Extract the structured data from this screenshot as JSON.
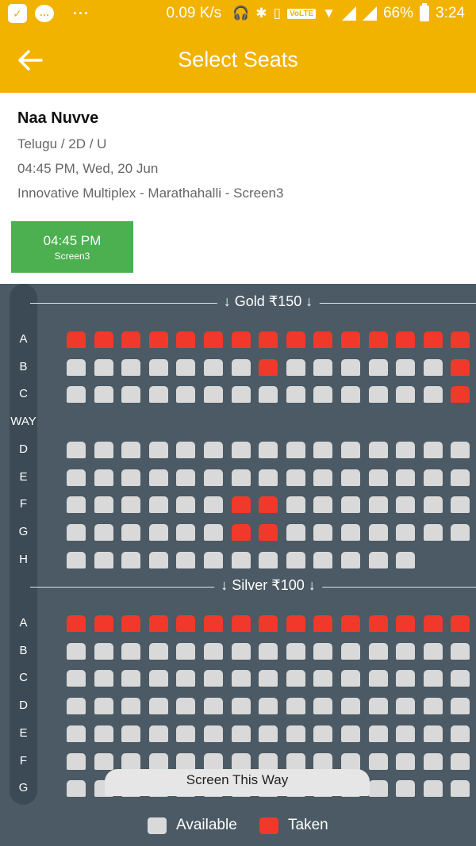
{
  "status_bar": {
    "speed": "0.09 K/s",
    "volte": "VoLTE",
    "battery": "66%",
    "time": "3:24",
    "dots": "···"
  },
  "app_bar": {
    "title": "Select Seats",
    "back_icon": "arrow-left-icon"
  },
  "movie": {
    "title": "Naa Nuvve",
    "meta": "Telugu / 2D / U",
    "datetime": "04:45 PM, Wed, 20 Jun",
    "venue": "Innovative Multiplex - Marathahalli - Screen3"
  },
  "showtime": {
    "time": "04:45 PM",
    "screen": "Screen3"
  },
  "colors": {
    "accent": "#f2b200",
    "available": "#d9d9d9",
    "taken": "#f0392b",
    "seat_bg": "#4b5a64",
    "showtime": "#4caf50"
  },
  "sections": [
    {
      "label": "↓ Gold ₹150 ↓",
      "rows": [
        {
          "label": "A",
          "seats": "TTTTTTTTTTTTTTTT"
        },
        {
          "label": "B",
          "seats": "AAAAAAATAAAAAATT"
        },
        {
          "label": "C",
          "seats": "AAAAAAAAAAAAAATT"
        },
        {
          "label": "WAY",
          "seats": ""
        },
        {
          "label": "D",
          "seats": "AAAAAAAAAAAAAAA"
        },
        {
          "label": "E",
          "seats": "AAAAAAAAAAAAAAA"
        },
        {
          "label": "F",
          "seats": "AAAAAATTAAAAAAA"
        },
        {
          "label": "G",
          "seats": "AAAAAATTAAAAAAA"
        },
        {
          "label": "H",
          "seats": "AAAAAAAAAAAAA"
        }
      ]
    },
    {
      "label": "↓ Silver ₹100 ↓",
      "rows": [
        {
          "label": "A",
          "seats": "TTTTTTTTTTTTTTTT"
        },
        {
          "label": "B",
          "seats": "AAAAAAAAAAAAAAAA"
        },
        {
          "label": "C",
          "seats": "AAAAAAAAAAAAAAAA"
        },
        {
          "label": "D",
          "seats": "AAAAAAAAAAAAAAAA"
        },
        {
          "label": "E",
          "seats": "AAAAAAAAAAAAAAAA"
        },
        {
          "label": "F",
          "seats": "AAAAAAAAAAAAAAAA"
        },
        {
          "label": "G",
          "seats": "AAAAAAAAAAAAAAAA"
        }
      ]
    }
  ],
  "screen_label": "Screen This Way",
  "legend": {
    "available": "Available",
    "taken": "Taken"
  }
}
